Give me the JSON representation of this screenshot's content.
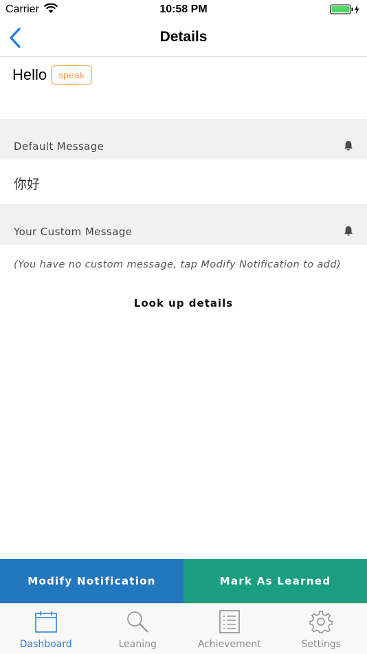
{
  "status_bar": {
    "carrier": "Carrier",
    "time": "10:58 PM"
  },
  "nav": {
    "title": "Details"
  },
  "word": {
    "text": "Hello",
    "speak_label": "speak"
  },
  "default_section": {
    "label": "Default Message",
    "message": "你好"
  },
  "custom_section": {
    "label": "Your Custom Message",
    "message": "(You have no custom message, tap Modify Notification to add)"
  },
  "lookup_label": "Look up details",
  "actions": {
    "modify_label": "Modify Notification",
    "learned_label": "Mark As Learned"
  },
  "tabs": [
    {
      "label": "Dashboard",
      "icon": "calendar-icon",
      "active": true
    },
    {
      "label": "Leaning",
      "icon": "search-icon",
      "active": false
    },
    {
      "label": "Achievement",
      "icon": "list-icon",
      "active": false
    },
    {
      "label": "Settings",
      "icon": "gear-icon",
      "active": false
    }
  ],
  "colors": {
    "accent": "#2f80d8",
    "speak": "#f5a14a",
    "modify": "#2277be",
    "learned": "#1a9e81"
  }
}
